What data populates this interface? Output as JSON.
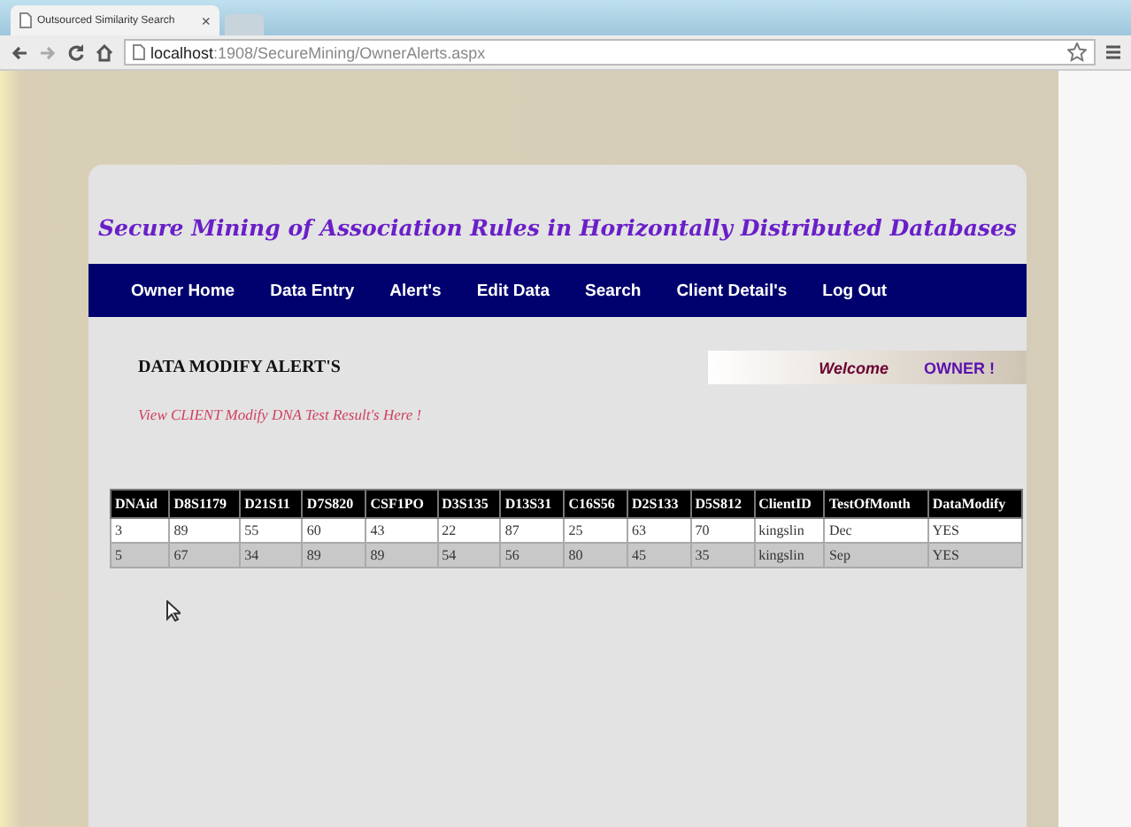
{
  "browser": {
    "tab_title": "Outsourced Similarity Search",
    "tab_close": "×",
    "url_host": "localhost",
    "url_path": ":1908/SecureMining/OwnerAlerts.aspx"
  },
  "page": {
    "title": "Secure Mining of Association Rules in Horizontally Distributed Databases",
    "nav": [
      {
        "label": "Owner Home"
      },
      {
        "label": "Data Entry"
      },
      {
        "label": "Alert's"
      },
      {
        "label": "Edit Data"
      },
      {
        "label": "Search"
      },
      {
        "label": "Client Detail's"
      },
      {
        "label": "Log Out"
      }
    ],
    "heading": "DATA MODIFY ALERT'S",
    "welcome": "Welcome",
    "user": "OWNER !",
    "subtitle": "View CLIENT Modify DNA Test Result's Here !",
    "table": {
      "columns": [
        "DNAid",
        "D8S1179",
        "D21S11",
        "D7S820",
        "CSF1PO",
        "D3S135",
        "D13S31",
        "C16S56",
        "D2S133",
        "D5S812",
        "ClientID",
        "TestOfMonth",
        "DataModify"
      ],
      "rows": [
        [
          "3",
          "89",
          "55",
          "60",
          "43",
          "22",
          "87",
          "25",
          "63",
          "70",
          "kingslin",
          "Dec",
          "YES"
        ],
        [
          "5",
          "67",
          "34",
          "89",
          "89",
          "54",
          "56",
          "80",
          "45",
          "35",
          "kingslin",
          "Sep",
          "YES"
        ]
      ]
    }
  }
}
